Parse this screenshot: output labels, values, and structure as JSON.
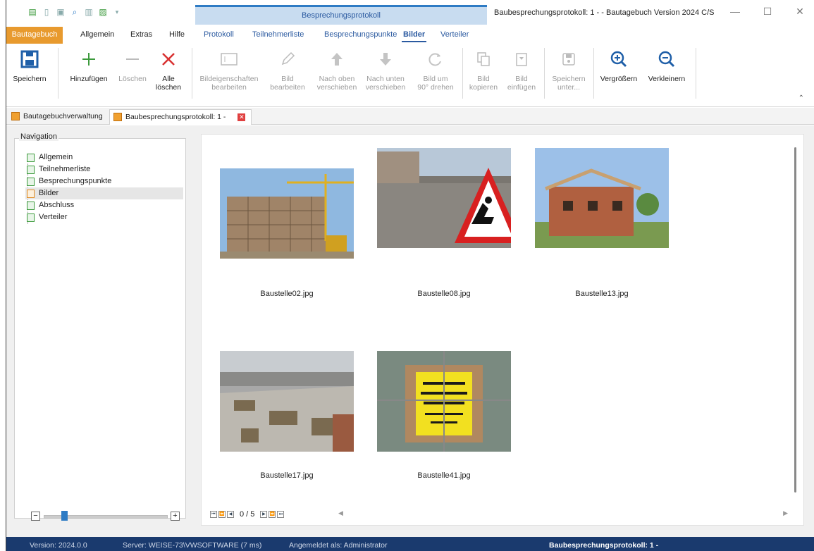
{
  "titlebar": {
    "context_tab": "Besprechungsprotokoll",
    "window_title": "Baubesprechungsprotokoll: 1 -  - Bautagebuch Version 2024 C/S"
  },
  "tabs": {
    "file": "Bautagebuch",
    "allgemein": "Allgemein",
    "extras": "Extras",
    "hilfe": "Hilfe",
    "protokoll": "Protokoll",
    "teilnehmerliste": "Teilnehmerliste",
    "besprechungspunkte": "Besprechungspunkte",
    "bilder": "Bilder",
    "verteiler": "Verteiler"
  },
  "ribbon": {
    "speichern": "Speichern",
    "hinzufuegen": "Hinzufügen",
    "loeschen": "Löschen",
    "alle_loeschen_1": "Alle",
    "alle_loeschen_2": "löschen",
    "bildeig_1": "Bildeigenschaften",
    "bildeig_2": "bearbeiten",
    "bild_bearb_1": "Bild",
    "bild_bearb_2": "bearbeiten",
    "oben_1": "Nach oben",
    "oben_2": "verschieben",
    "unten_1": "Nach unten",
    "unten_2": "verschieben",
    "drehen_1": "Bild um",
    "drehen_2": "90° drehen",
    "kopieren_1": "Bild",
    "kopieren_2": "kopieren",
    "einfuegen_1": "Bild",
    "einfuegen_2": "einfügen",
    "speichern_unter_1": "Speichern",
    "speichern_unter_2": "unter...",
    "vergroessern": "Vergrößern",
    "verkleinern": "Verkleinern"
  },
  "doctabs": {
    "tab1": "Bautagebuchverwaltung",
    "tab2": "Baubesprechungsprotokoll: 1 -"
  },
  "navigation": {
    "legend": "Navigation",
    "items": [
      "Allgemein",
      "Teilnehmerliste",
      "Besprechungspunkte",
      "Bilder",
      "Abschluss",
      "Verteiler"
    ],
    "selected": "Bilder"
  },
  "zoom": {
    "minus": "−",
    "plus": "+"
  },
  "gallery": {
    "images": [
      {
        "caption": "Baustelle02.jpg"
      },
      {
        "caption": "Baustelle08.jpg"
      },
      {
        "caption": "Baustelle13.jpg"
      },
      {
        "caption": "Baustelle17.jpg"
      },
      {
        "caption": "Baustelle41.jpg"
      }
    ],
    "pager": "0 / 5"
  },
  "status": {
    "version": "Version: 2024.0.0",
    "server": "Server: WEISE-73\\VWSOFTWARE (7 ms)",
    "user": "Angemeldet als: Administrator",
    "document": "Baubesprechungsprotokoll: 1 -"
  },
  "colors": {
    "accent": "#2b5aa0",
    "file_tab": "#e89a2e",
    "status_bar": "#1a3a6e"
  }
}
